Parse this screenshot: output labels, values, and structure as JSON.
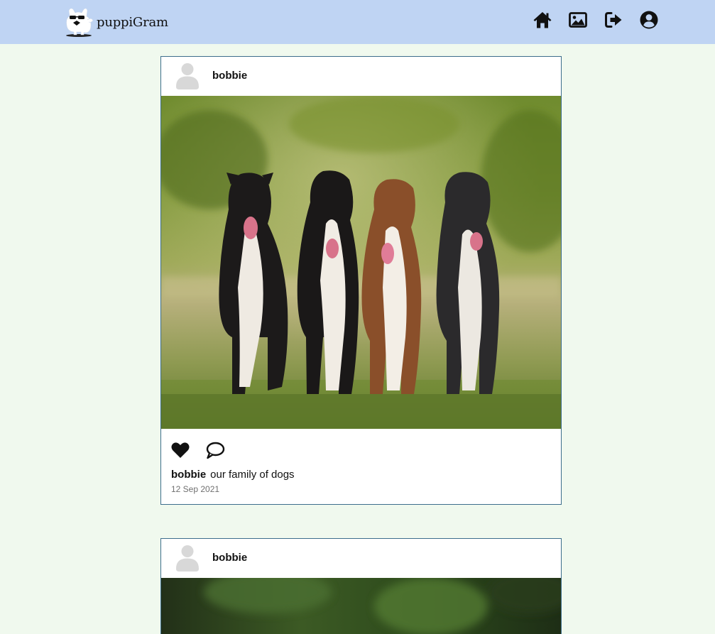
{
  "app": {
    "brand": "puppiGram"
  },
  "nav": [
    {
      "name": "home-icon"
    },
    {
      "name": "image-icon"
    },
    {
      "name": "logout-icon"
    },
    {
      "name": "user-circle-icon"
    }
  ],
  "posts": [
    {
      "username": "bobbie",
      "caption_user": "bobbie",
      "caption": "our family of dogs",
      "date": "12 Sep 2021",
      "liked": true
    },
    {
      "username": "bobbie"
    }
  ],
  "colors": {
    "background": "#f0f9ee",
    "header": "#bfd4f3",
    "card_border": "#3d6e8c",
    "date_text": "#707070"
  }
}
